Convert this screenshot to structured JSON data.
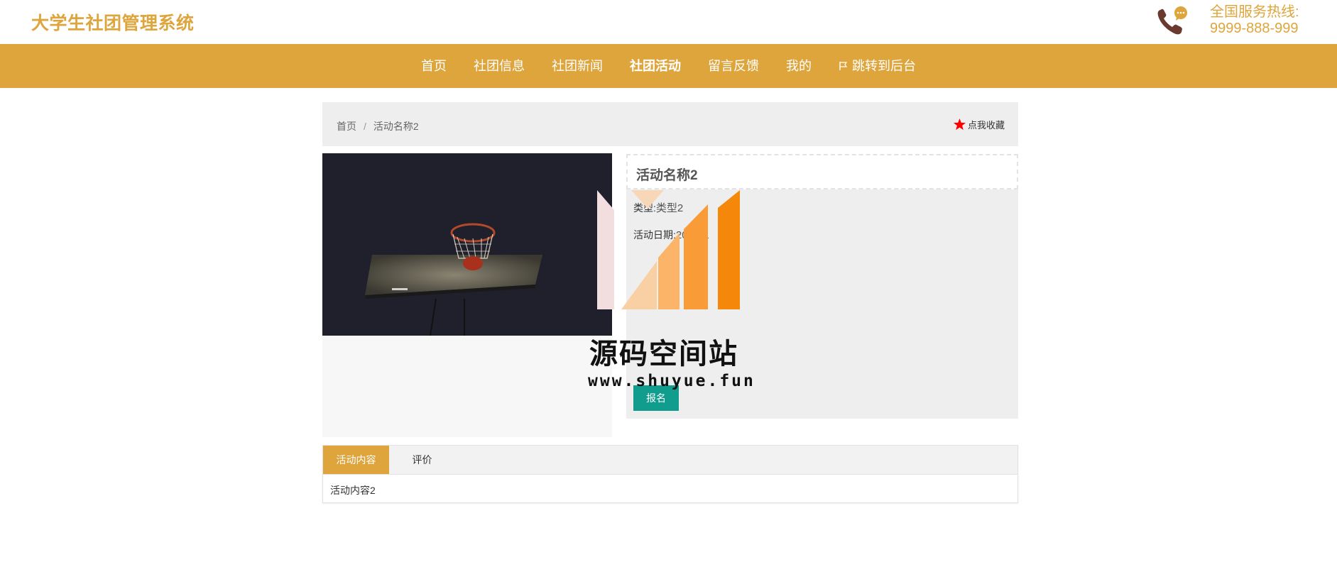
{
  "header": {
    "site_title": "大学生社团管理系统",
    "hotline_label": "全国服务热线:",
    "hotline_number": "9999-888-999"
  },
  "nav": {
    "items": [
      {
        "label": "首页"
      },
      {
        "label": "社团信息"
      },
      {
        "label": "社团新闻"
      },
      {
        "label": "社团活动",
        "active": true
      },
      {
        "label": "留言反馈"
      },
      {
        "label": "我的"
      },
      {
        "label": "跳转到后台",
        "icon": "flag-icon"
      }
    ]
  },
  "breadcrumb": {
    "home": "首页",
    "separator": "/",
    "current": "活动名称2"
  },
  "favorite": {
    "label": "点我收藏",
    "icon": "star-icon",
    "icon_color": "#ff0000"
  },
  "detail": {
    "title": "活动名称2",
    "type_label": "类型:",
    "type_value": "类型2",
    "date_label": "活动日期:",
    "date_value": "2020-1",
    "signup_label": "报名"
  },
  "tabs": {
    "items": [
      {
        "label": "活动内容",
        "active": true
      },
      {
        "label": "评价"
      }
    ],
    "content": "活动内容2"
  },
  "watermark": {
    "text": "源码空间站",
    "url": "www.shuyue.fun"
  },
  "colors": {
    "accent": "#dea53c",
    "button": "#119d8e",
    "panel_bg": "#eeeeee"
  }
}
